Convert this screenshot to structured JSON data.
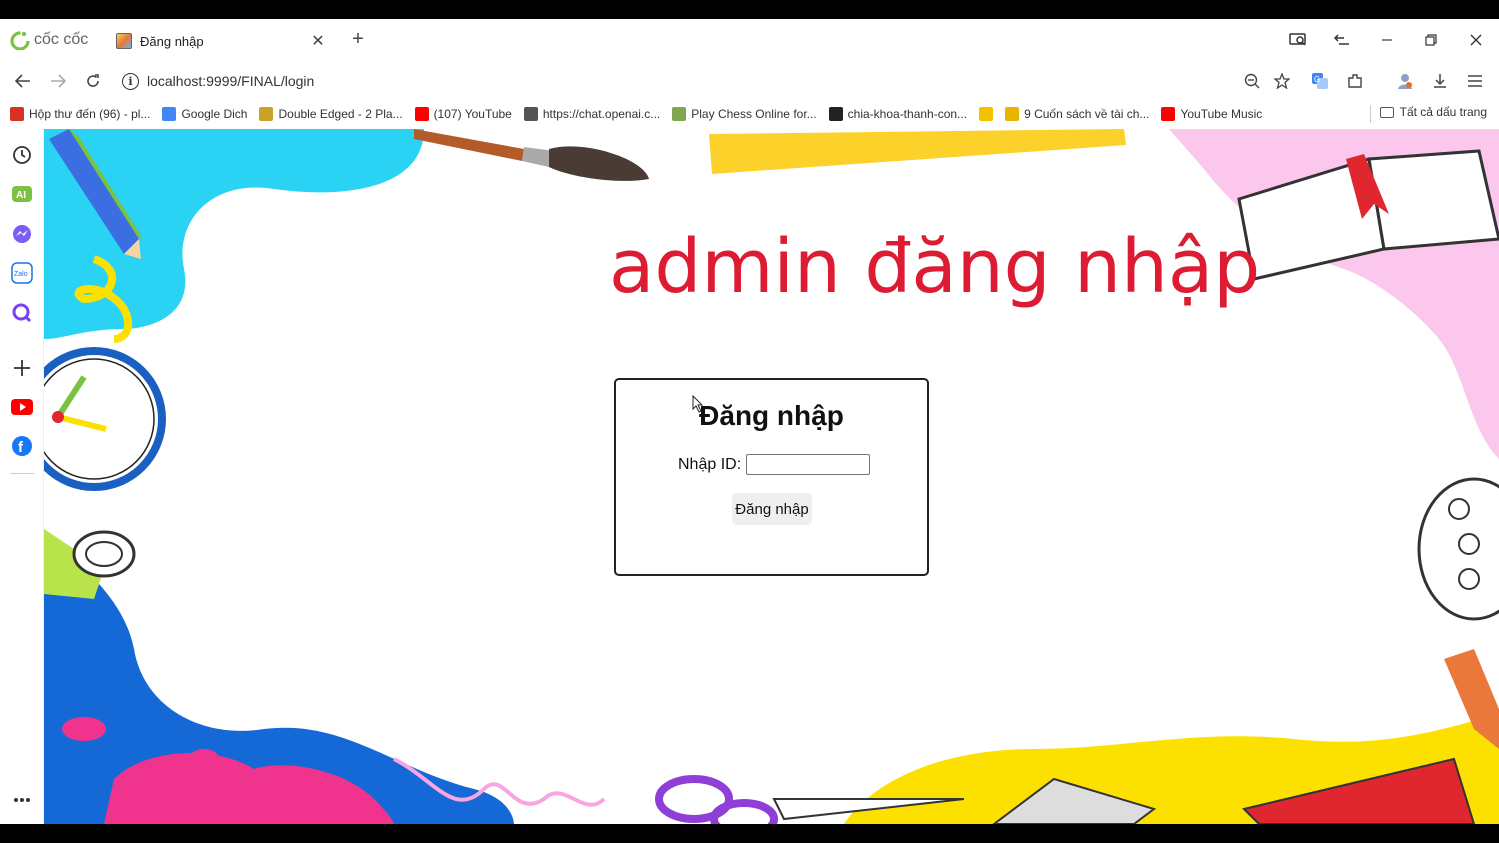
{
  "browser": {
    "brand": "cốc cốc",
    "tab_title": "Đăng nhập",
    "url": "localhost:9999/FINAL/login"
  },
  "bookmarks": [
    {
      "label": "Hộp thư đến (96) - pl...",
      "icon": "gmail-icon",
      "color": "#d93025"
    },
    {
      "label": "Google Dich",
      "icon": "google-translate-icon",
      "color": "#4285f4"
    },
    {
      "label": "Double Edged - 2 Pla...",
      "icon": "game-icon",
      "color": "#c9a227"
    },
    {
      "label": "(107) YouTube",
      "icon": "youtube-icon",
      "color": "#ff0000"
    },
    {
      "label": "https://chat.openai.c...",
      "icon": "openai-icon",
      "color": "#555555"
    },
    {
      "label": "Play Chess Online for...",
      "icon": "chess-icon",
      "color": "#7fa650"
    },
    {
      "label": "chia-khoa-thanh-con...",
      "icon": "github-icon",
      "color": "#222222"
    },
    {
      "label": "",
      "icon": "n-bookmark-icon",
      "color": "#f2c200"
    },
    {
      "label": "9 Cuốn sách về tài ch...",
      "icon": "plant-icon",
      "color": "#e8b400"
    },
    {
      "label": "YouTube Music",
      "icon": "youtube-music-icon",
      "color": "#ff0000"
    }
  ],
  "all_bookmarks_label": "Tất cả dấu trang",
  "page": {
    "heading": "admin đăng nhập",
    "login_title": "Đăng nhập",
    "id_label": "Nhập ID:",
    "id_value": "",
    "submit_label": "Đăng nhập"
  },
  "colors": {
    "heading": "#dd1c33",
    "blue_splash": "#2ad2f3",
    "pink_splash": "#fbc7ec",
    "yellow_splash": "#fbe000",
    "deep_blue": "#1469d6"
  }
}
